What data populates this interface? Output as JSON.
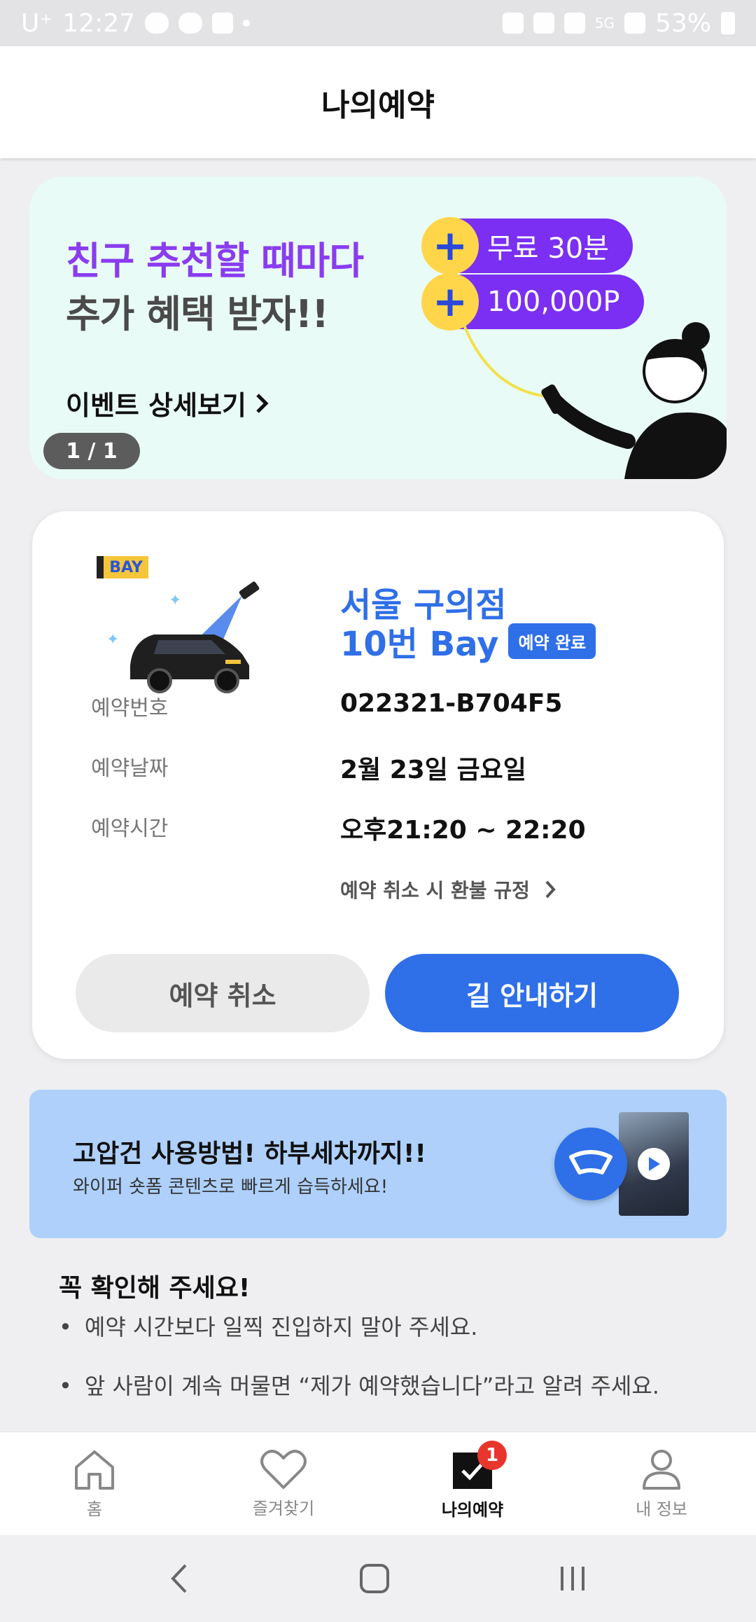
{
  "status_bar": {
    "carrier": "U⁺",
    "time": "12:27",
    "network": "5G",
    "battery": "53%"
  },
  "header": {
    "title": "나의예약"
  },
  "banner": {
    "line1": "친구 추천할 때마다",
    "line2": "추가 혜택 받자!!",
    "pill_free": "무료 30분",
    "pill_points": "100,000P",
    "detail_link": "이벤트 상세보기",
    "pager": "1 / 1"
  },
  "reservation": {
    "bay_tag": "BAY",
    "store": "서울 구의점",
    "bay": "10번 Bay",
    "status": "예약 완료",
    "rows": [
      {
        "label": "예약번호",
        "value": "022321-B704F5"
      },
      {
        "label": "예약날짜",
        "value": "2월 23일 금요일"
      },
      {
        "label": "예약시간",
        "value": "오후21:20 ~ 22:20"
      }
    ],
    "refund_link": "예약 취소 시 환불 규정",
    "cancel_button": "예약 취소",
    "navigate_button": "길 안내하기"
  },
  "promo": {
    "title": "고압건 사용방법! 하부세차까지!!",
    "subtitle": "와이퍼 숏폼 콘텐츠로 빠르게 습득하세요!"
  },
  "notice": {
    "title": "꼭 확인해 주세요!",
    "items": [
      "예약 시간보다 일찍 진입하지 말아 주세요.",
      "앞 사람이 계속 머물면 “제가 예약했습니다”라고 알려 주세요."
    ]
  },
  "bottom_nav": {
    "items": [
      {
        "label": "홈",
        "icon": "home-icon"
      },
      {
        "label": "즐겨찾기",
        "icon": "heart-icon"
      },
      {
        "label": "나의예약",
        "icon": "calendar-check-icon",
        "badge": "1"
      },
      {
        "label": "내 정보",
        "icon": "person-icon"
      }
    ]
  },
  "colors": {
    "accent": "#2f6fe8",
    "banner_purple": "#8a3cf0",
    "badge_red": "#e8362d"
  }
}
